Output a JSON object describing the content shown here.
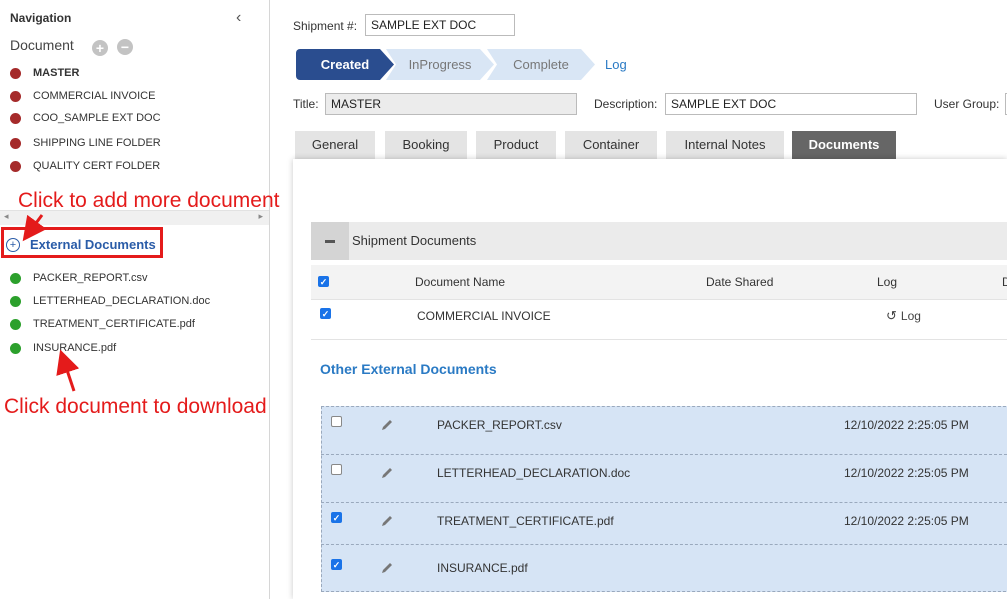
{
  "sidebar": {
    "title": "Navigation",
    "collapse_icon": "‹",
    "document_label": "Document",
    "documents": [
      {
        "name": "MASTER",
        "color": "#a52a2a"
      },
      {
        "name": "COMMERCIAL INVOICE",
        "color": "#a52a2a"
      },
      {
        "name": "COO_SAMPLE EXT DOC",
        "color": "#a52a2a"
      },
      {
        "name": "SHIPPING LINE FOLDER",
        "color": "#a52a2a"
      },
      {
        "name": "QUALITY CERT FOLDER",
        "color": "#a52a2a"
      }
    ],
    "external_link": "External Documents",
    "external_docs": [
      {
        "name": "PACKER_REPORT.csv"
      },
      {
        "name": "LETTERHEAD_DECLARATION.doc"
      },
      {
        "name": "TREATMENT_CERTIFICATE.pdf"
      },
      {
        "name": "INSURANCE.pdf"
      }
    ]
  },
  "annotations": {
    "add_more": "Click to add more document",
    "download": "Click document to download"
  },
  "header": {
    "shipment_label": "Shipment #:",
    "shipment_value": "SAMPLE EXT DOC",
    "steps": [
      "Created",
      "InProgress",
      "Complete"
    ],
    "log_link": "Log",
    "title_label": "Title:",
    "title_value": "MASTER",
    "description_label": "Description:",
    "description_value": "SAMPLE EXT DOC",
    "user_group_label": "User Group:"
  },
  "tabs": [
    "General",
    "Booking",
    "Product",
    "Container",
    "Internal Notes",
    "Documents"
  ],
  "active_tab": "Documents",
  "shipment_documents": {
    "section_title": "Shipment Documents",
    "columns": [
      "Document Name",
      "Date Shared",
      "Log",
      "D"
    ],
    "rows": [
      {
        "name": "COMMERCIAL INVOICE",
        "log": "Log",
        "checked": true
      }
    ]
  },
  "other_external": {
    "title": "Other External Documents",
    "rows": [
      {
        "name": "PACKER_REPORT.csv",
        "date": "12/10/2022 2:25:05 PM",
        "checked": false
      },
      {
        "name": "LETTERHEAD_DECLARATION.doc",
        "date": "12/10/2022 2:25:05 PM",
        "checked": false
      },
      {
        "name": "TREATMENT_CERTIFICATE.pdf",
        "date": "12/10/2022 2:25:05 PM",
        "checked": true
      },
      {
        "name": "INSURANCE.pdf",
        "date": "",
        "checked": true
      }
    ]
  },
  "colors": {
    "accent": "#2a4d8f",
    "link": "#2a7ac4",
    "annotation_red": "#e41b1b",
    "status_green": "#2ca02c",
    "status_red": "#a52a2a"
  }
}
